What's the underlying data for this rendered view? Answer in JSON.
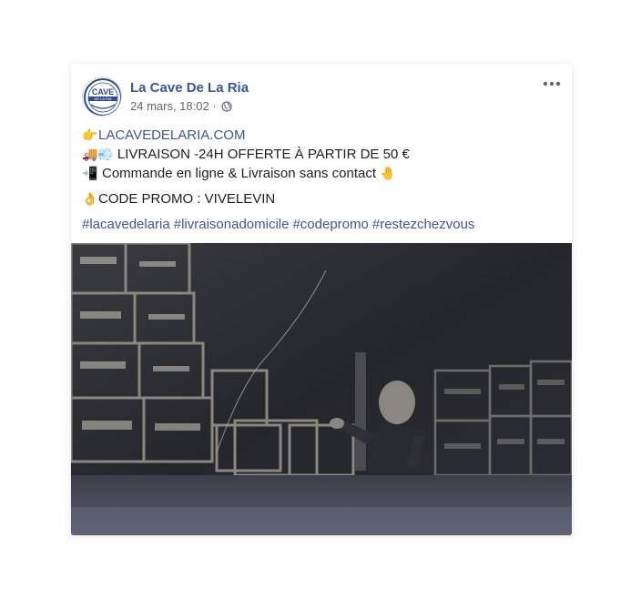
{
  "post": {
    "page_name": "La Cave De La Ria",
    "timestamp": "24 mars, 18:02",
    "meta_separator": "·",
    "avatar_text_top": "CAVE",
    "avatar_text_bottom": "DE LA RIA",
    "lines": {
      "link_emoji": "👉",
      "link_text": "LACAVEDELARIA.COM",
      "delivery_emojis": "🚚💨",
      "delivery_text": "LIVRAISON -24H OFFERTE À PARTIR DE 50 €",
      "order_emoji": "📲",
      "order_text": "Commande en ligne & Livraison sans contact",
      "order_trailing_emoji": "🤚",
      "promo_emoji": "👌",
      "promo_text": "CODE PROMO : VIVELEVIN"
    },
    "hashtags": [
      "#lacavedelaria",
      "#livraisonadomicile",
      "#codepromo",
      "#restezchezvous"
    ]
  },
  "icons": {
    "globe": "globe-icon",
    "more": "more-options-icon"
  },
  "colors": {
    "link": "#385898",
    "text": "#1c1e21",
    "meta": "#616770"
  }
}
